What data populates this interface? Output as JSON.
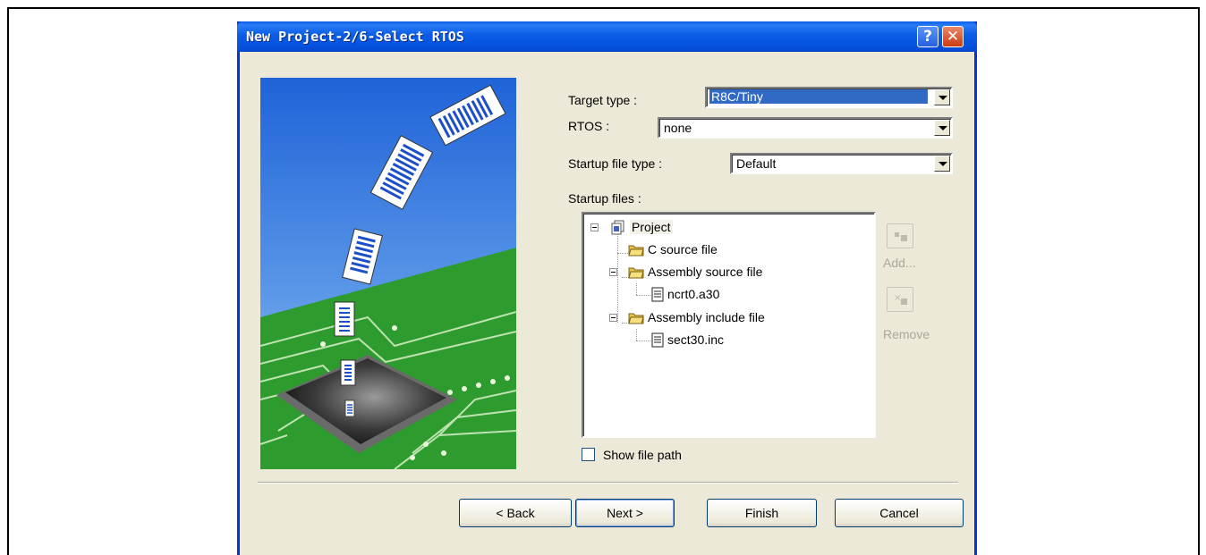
{
  "dialog": {
    "title": "New Project-2/6-Select RTOS",
    "help_label": "?",
    "close_label": "✕"
  },
  "form": {
    "target_type_label": "Target type :",
    "target_type_value": "R8C/Tiny",
    "rtos_label": "RTOS :",
    "rtos_value": "none",
    "startup_file_type_label": "Startup file type :",
    "startup_file_type_value": "Default",
    "startup_files_label": "Startup files :"
  },
  "tree": {
    "project": "Project",
    "c_source": "C source file",
    "asm_source": "Assembly source file",
    "asm_source_file": "ncrt0.a30",
    "asm_include": "Assembly include file",
    "asm_include_file": "sect30.inc"
  },
  "side_buttons": {
    "add_label": "Add...",
    "remove_label": "Remove"
  },
  "show_file_path_label": "Show file path",
  "buttons": {
    "back": "< Back",
    "next": "Next >",
    "finish": "Finish",
    "cancel": "Cancel"
  },
  "colors": {
    "titlebar": "#0a5ce6",
    "dialog_bg": "#ece9d8",
    "selection": "#316ac5"
  }
}
